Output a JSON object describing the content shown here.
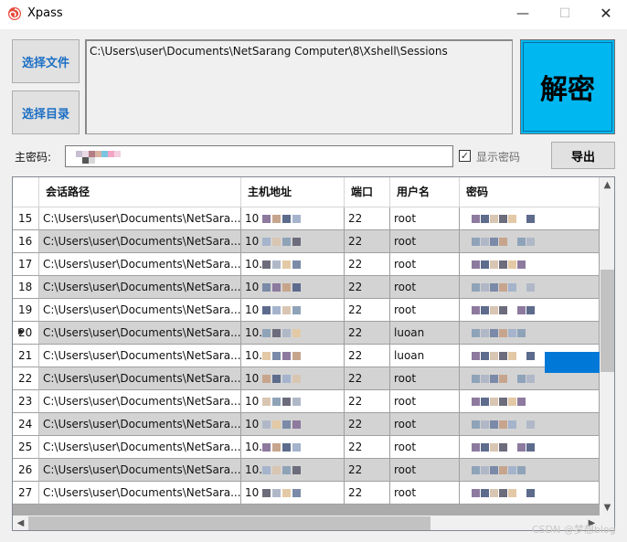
{
  "window": {
    "title": "Xpass",
    "min": "—",
    "max": "☐",
    "close": "✕"
  },
  "buttons": {
    "select_file": "选择文件",
    "select_dir": "选择目录",
    "decrypt": "解密",
    "export": "导出"
  },
  "path_text": "C:\\Users\\user\\Documents\\NetSarang Computer\\8\\Xshell\\Sessions",
  "master_password": {
    "label": "主密码:",
    "show_label": "显示密码",
    "show_checked": true
  },
  "table": {
    "headers": [
      "会话路径",
      "主机地址",
      "端口",
      "用户名",
      "密码"
    ],
    "selected_row": 20,
    "rows": [
      {
        "no": "15",
        "path": "C:\\Users\\user\\Documents\\NetSara...",
        "host": "10",
        "port": "22",
        "user": "root"
      },
      {
        "no": "16",
        "path": "C:\\Users\\user\\Documents\\NetSara...",
        "host": "10",
        "port": "22",
        "user": "root"
      },
      {
        "no": "17",
        "path": "C:\\Users\\user\\Documents\\NetSara...",
        "host": "10.",
        "port": "22",
        "user": "root"
      },
      {
        "no": "18",
        "path": "C:\\Users\\user\\Documents\\NetSara...",
        "host": "10",
        "port": "22",
        "user": "root"
      },
      {
        "no": "19",
        "path": "C:\\Users\\user\\Documents\\NetSara...",
        "host": "10",
        "port": "22",
        "user": "root"
      },
      {
        "no": "20",
        "path": "C:\\Users\\user\\Documents\\NetSara...",
        "host": "10.",
        "port": "22",
        "user": "luoan"
      },
      {
        "no": "21",
        "path": "C:\\Users\\user\\Documents\\NetSara...",
        "host": "10.",
        "port": "22",
        "user": "luoan"
      },
      {
        "no": "22",
        "path": "C:\\Users\\user\\Documents\\NetSara...",
        "host": "10",
        "port": "22",
        "user": "root"
      },
      {
        "no": "23",
        "path": "C:\\Users\\user\\Documents\\NetSara...",
        "host": "10",
        "port": "22",
        "user": "root"
      },
      {
        "no": "24",
        "path": "C:\\Users\\user\\Documents\\NetSara...",
        "host": "10",
        "port": "22",
        "user": "root"
      },
      {
        "no": "25",
        "path": "C:\\Users\\user\\Documents\\NetSara...",
        "host": "10.",
        "port": "22",
        "user": "root"
      },
      {
        "no": "26",
        "path": "C:\\Users\\user\\Documents\\NetSara...",
        "host": "10.",
        "port": "22",
        "user": "root"
      },
      {
        "no": "27",
        "path": "C:\\Users\\user\\Documents\\NetSara...",
        "host": "10",
        "port": "22",
        "user": "root"
      }
    ]
  },
  "watermark": "CSDN @梦想blog",
  "colors": {
    "accent": "#00b7f0",
    "selection": "#0078d7",
    "label_blue": "#1c6fc4",
    "row_alt": "#d3d3d3"
  },
  "icons": {
    "app": "spiral-icon",
    "checkbox": "check-icon",
    "row_pointer": "row-pointer-icon"
  }
}
